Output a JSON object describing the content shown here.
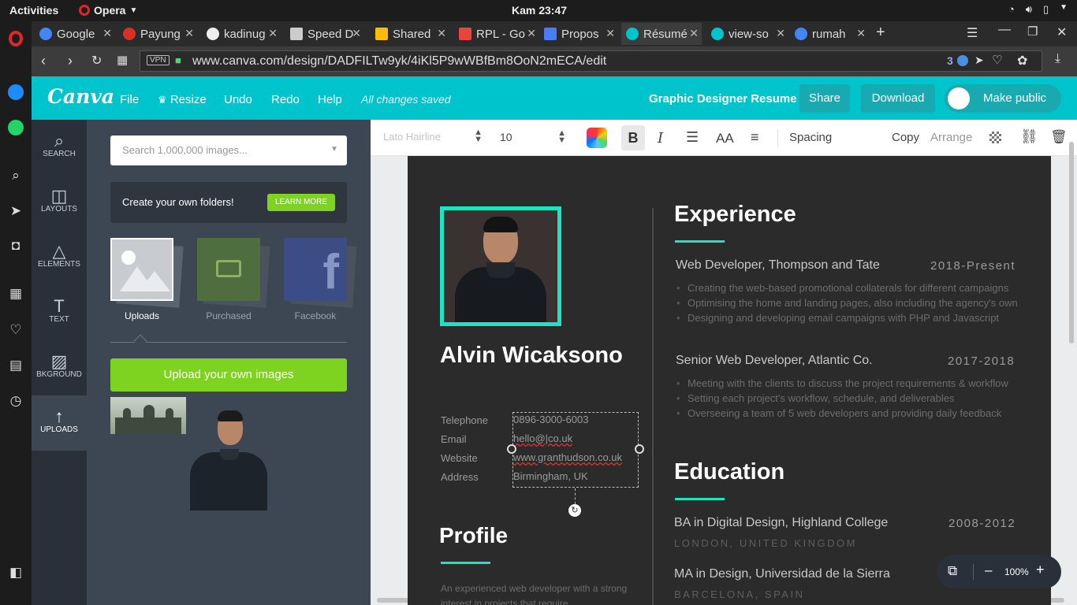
{
  "system": {
    "activities": "Activities",
    "app": "Opera",
    "clock": "Kam 23:47"
  },
  "tabs": [
    {
      "label": "Google",
      "color": "#4285f4"
    },
    {
      "label": "Payung",
      "color": "#d93025"
    },
    {
      "label": "kadinug",
      "color": "#ffffff"
    },
    {
      "label": "Speed D",
      "color": "#cccccc"
    },
    {
      "label": "Shared",
      "color": "#fbbc04"
    },
    {
      "label": "RPL - Go",
      "color": "#e8453c"
    },
    {
      "label": "Propos",
      "color": "#4a7cf7"
    },
    {
      "label": "Résumé",
      "color": "#00c4cc"
    },
    {
      "label": "view-so",
      "color": "#00c4cc"
    },
    {
      "label": "rumah",
      "color": "#4285f4"
    }
  ],
  "address": {
    "vpn": "VPN",
    "url": "www.canva.com/design/DADFILTw9yk/4iKl5P9wWBfBm8OoN2mECA/edit",
    "badge_count": "3"
  },
  "header": {
    "logo": "Canva",
    "file": "File",
    "resize": "Resize",
    "undo": "Undo",
    "redo": "Redo",
    "help": "Help",
    "saved": "All changes saved",
    "design_title": "Graphic Designer Resume",
    "share": "Share",
    "download": "Download",
    "make_public": "Make public"
  },
  "rail": [
    {
      "label": "SEARCH",
      "icon": "search-icon"
    },
    {
      "label": "LAYOUTS",
      "icon": "layouts-icon"
    },
    {
      "label": "ELEMENTS",
      "icon": "elements-icon"
    },
    {
      "label": "TEXT",
      "icon": "text-icon"
    },
    {
      "label": "BKGROUND",
      "icon": "background-icon"
    },
    {
      "label": "UPLOADS",
      "icon": "upload-icon"
    }
  ],
  "panel": {
    "search_placeholder": "Search 1,000,000 images...",
    "folders_text": "Create your own folders!",
    "learn_more": "LEARN MORE",
    "sources": [
      "Uploads",
      "Purchased",
      "Facebook"
    ],
    "upload_button": "Upload your own images"
  },
  "toolbar": {
    "font": "Lato Hairline",
    "size": "10",
    "bold": "B",
    "italic": "I",
    "case": "AA",
    "spacing": "Spacing",
    "copy": "Copy",
    "arrange": "Arrange"
  },
  "resume": {
    "name": "Alvin Wicaksono",
    "contact_labels": [
      "Telephone",
      "Email",
      "Website",
      "Address"
    ],
    "contact_values": [
      "0896-3000-6003",
      "hello@|co.uk",
      "www.granthudson.co.uk",
      "Birmingham, UK"
    ],
    "profile_heading": "Profile",
    "profile_text": "An experienced web developer with a strong interest in projects that require",
    "experience_heading": "Experience",
    "jobs": [
      {
        "title": "Web Developer, Thompson and Tate",
        "period": "2018-Present",
        "bullets": [
          "Creating  the web-based promotional collaterals for different campaigns",
          "Optimising the home and landing pages, also including the agency's own",
          "Designing and developing email campaigns with PHP and Javascript"
        ]
      },
      {
        "title": "Senior Web Developer, Atlantic Co.",
        "period": "2017-2018",
        "bullets": [
          "Meeting with the clients to discuss the project requirements & workflow",
          "Setting each project's workflow, schedule, and deliverables",
          "Overseeing a team of 5 web developers and providing daily feedback"
        ]
      }
    ],
    "education_heading": "Education",
    "education": [
      {
        "degree": "BA in Digital Design, Highland College",
        "place": "LONDON, UNITED KINGDOM",
        "period": "2008-2012"
      },
      {
        "degree": "MA in Design, Universidad de la Sierra",
        "place": "BARCELONA, SPAIN",
        "period": ""
      }
    ]
  },
  "zoom": {
    "minus": "–",
    "level": "100%",
    "plus": "+"
  }
}
